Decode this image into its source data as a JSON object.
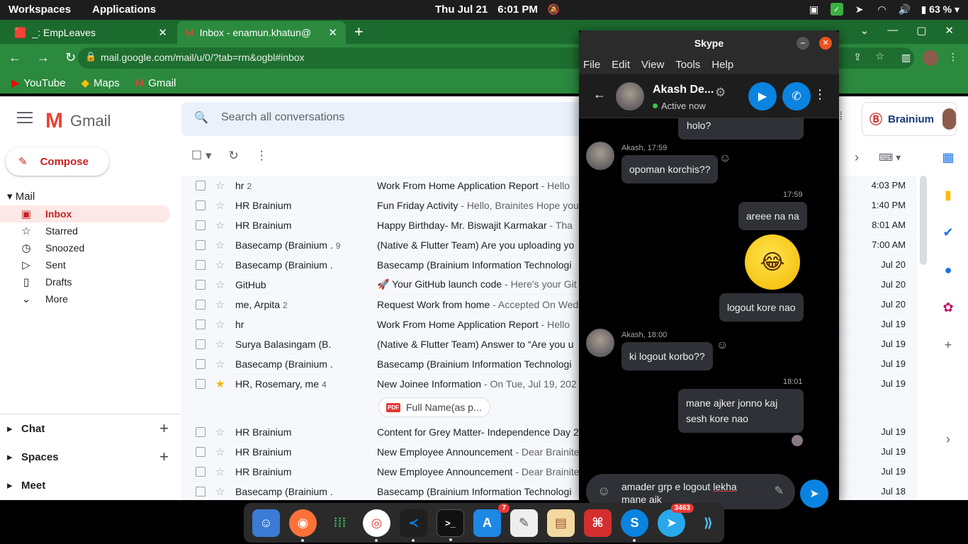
{
  "topbar": {
    "workspaces": "Workspaces",
    "applications": "Applications",
    "date": "Thu Jul 21",
    "time": "6:01 PM",
    "battery": "63 %"
  },
  "browser": {
    "tabs": [
      {
        "title": "_: EmpLeaves"
      },
      {
        "title": "Inbox - enamun.khatun@"
      }
    ],
    "url": "mail.google.com/mail/u/0/?tab=rm&ogbl#inbox",
    "bookmarks": [
      "YouTube",
      "Maps",
      "Gmail"
    ]
  },
  "gmail": {
    "logo_text": "Gmail",
    "search_placeholder": "Search all conversations",
    "org": "Brainium",
    "compose": "Compose",
    "mail_section": "Mail",
    "nav": [
      "Inbox",
      "Starred",
      "Snoozed",
      "Sent",
      "Drafts",
      "More"
    ],
    "bottom": [
      "Chat",
      "Spaces",
      "Meet"
    ],
    "rows": [
      {
        "from": "hr",
        "count": "2",
        "subject": "Work From Home Application Report",
        "snippet": " - Hello",
        "date": "4:03 PM"
      },
      {
        "from": "HR Brainium",
        "count": "",
        "subject": "Fun Friday Activity",
        "snippet": " - Hello, Brainites Hope you",
        "date": "1:40 PM"
      },
      {
        "from": "HR Brainium",
        "count": "",
        "subject": "Happy Birthday- Mr. Biswajit Karmakar",
        "snippet": " - Tha",
        "date": "8:01 AM"
      },
      {
        "from": "Basecamp (Brainium .",
        "count": "9",
        "subject": "(Native & Flutter Team) Are you uploading yo",
        "snippet": "",
        "date": "7:00 AM"
      },
      {
        "from": "Basecamp (Brainium .",
        "count": "",
        "subject": "Basecamp (Brainium Information Technologi",
        "snippet": "",
        "date": "Jul 20"
      },
      {
        "from": "GitHub",
        "count": "",
        "subject": "🚀 Your GitHub launch code",
        "snippet": " - Here's your Git",
        "date": "Jul 20"
      },
      {
        "from": "me, Arpita",
        "count": "2",
        "subject": "Request Work from home",
        "snippet": " - Accepted On Wed",
        "date": "Jul 20"
      },
      {
        "from": "hr",
        "count": "",
        "subject": "Work From Home Application Report",
        "snippet": " - Hello",
        "date": "Jul 19"
      },
      {
        "from": "Surya Balasingam (B.",
        "count": "",
        "subject": "(Native & Flutter Team) Answer to “Are you u",
        "snippet": "",
        "date": "Jul 19"
      },
      {
        "from": "Basecamp (Brainium .",
        "count": "",
        "subject": "Basecamp (Brainium Information Technologi",
        "snippet": "",
        "date": "Jul 19"
      },
      {
        "from": "HR, Rosemary, me",
        "count": "4",
        "subject": "New Joinee Information",
        "snippet": " - On Tue, Jul 19, 202",
        "date": "Jul 19"
      },
      {
        "from": "HR Brainium",
        "count": "",
        "subject": "Content for Grey Matter- Independence Day 2",
        "snippet": "",
        "date": "Jul 19"
      },
      {
        "from": "HR Brainium",
        "count": "",
        "subject": "New Employee Announcement",
        "snippet": " - Dear Brainite",
        "date": "Jul 19"
      },
      {
        "from": "HR Brainium",
        "count": "",
        "subject": "New Employee Announcement",
        "snippet": " - Dear Brainite",
        "date": "Jul 19"
      },
      {
        "from": "Basecamp (Brainium .",
        "count": "",
        "subject": "Basecamp (Brainium Information Technologi",
        "snippet": "",
        "date": "Jul 18"
      }
    ],
    "attachment": "Full Name(as p..."
  },
  "skype": {
    "title": "Skype",
    "menu": [
      "File",
      "Edit",
      "View",
      "Tools",
      "Help"
    ],
    "contact": "Akash De...",
    "status": "Active now",
    "messages": {
      "m0": "holo?",
      "meta1": "Akash, 17:59",
      "m1": "opoman korchis??",
      "time2": "17:59",
      "m2": "areee na na",
      "m3": "logout kore nao",
      "meta4": "Akash, 18:00",
      "m4": "ki logout korbo??",
      "time5": "18:01",
      "m5a": "mane ajker jonno kaj",
      "m5b": "sesh kore nao"
    },
    "input": {
      "line1_a": "amader grp e logout ",
      "line1_b": "lekha",
      "line2": "mane aik"
    }
  },
  "dock": {
    "appstore_badge": "7",
    "telegram_badge": "3463"
  }
}
